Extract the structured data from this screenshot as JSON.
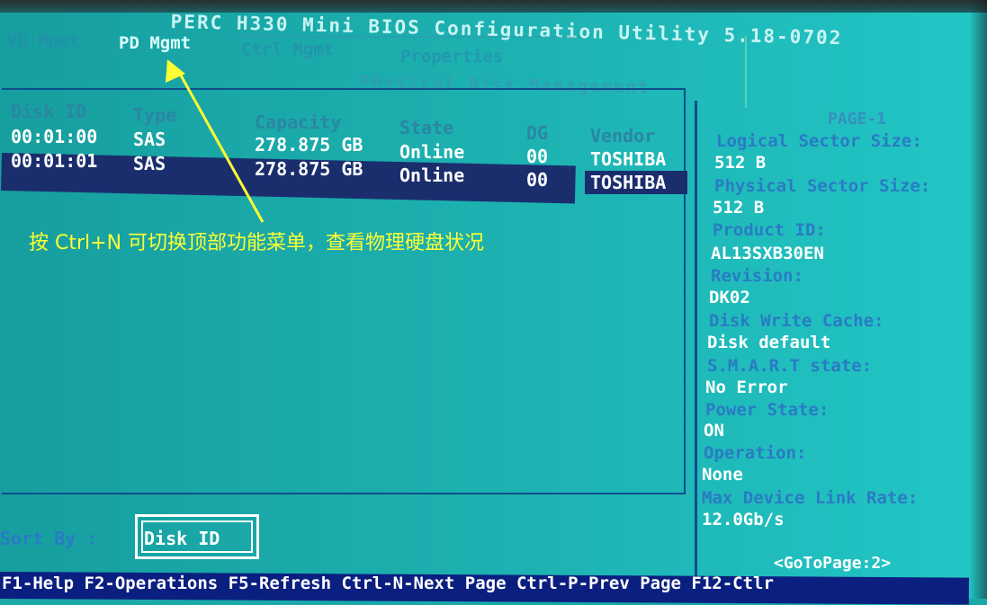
{
  "window": {
    "title": "PERC H330 Mini BIOS Configuration Utility 5.18-0702"
  },
  "menu": {
    "items": [
      {
        "label": "VD Mgmt"
      },
      {
        "label": "PD Mgmt"
      },
      {
        "label": "Ctrl Mgmt"
      },
      {
        "label": "Properties"
      }
    ],
    "active_index": 1
  },
  "panel": {
    "title": "Physical Disk Management"
  },
  "table": {
    "columns": [
      "Disk ID",
      "Type",
      "Capacity",
      "State",
      "DG",
      "Vendor"
    ],
    "rows": [
      {
        "disk_id": "00:01:00",
        "type": "SAS",
        "capacity": "278.875 GB",
        "state": "Online",
        "dg": "00",
        "vendor": "TOSHIBA"
      },
      {
        "disk_id": "00:01:01",
        "type": "SAS",
        "capacity": "278.875 GB",
        "state": "Online",
        "dg": "00",
        "vendor": "TOSHIBA"
      }
    ],
    "selected_row": 1
  },
  "details": {
    "page": "PAGE-1",
    "fields": [
      {
        "label": "Logical Sector Size:",
        "value": "512 B"
      },
      {
        "label": "Physical Sector Size:",
        "value": "512 B"
      },
      {
        "label": "Product ID:",
        "value": "AL13SXB30EN"
      },
      {
        "label": "Revision:",
        "value": "DK02"
      },
      {
        "label": "Disk Write Cache:",
        "value": "Disk default"
      },
      {
        "label": "S.M.A.R.T state:",
        "value": "No Error"
      },
      {
        "label": "Power State:",
        "value": "ON"
      },
      {
        "label": "Operation:",
        "value": "None"
      },
      {
        "label": "Max Device Link Rate:",
        "value": "12.0Gb/s"
      }
    ],
    "goto": "<GoToPage:2>"
  },
  "sort": {
    "label": "Sort By :",
    "value": "Disk ID"
  },
  "footer": {
    "shortcuts": "F1-Help F2-Operations F5-Refresh Ctrl-N-Next Page Ctrl-P-Prev Page F12-Ctlr"
  },
  "annotation": {
    "text": "按 Ctrl+N 可切换顶部功能菜单，查看物理硬盘状况",
    "color": "#ffff33"
  },
  "colors": {
    "background": "#1aa8a8",
    "frame": "#0f4e8c",
    "selection": "#1a2e6e",
    "label_blue": "#2a7bc4",
    "footer_bg": "#0b1f80"
  }
}
